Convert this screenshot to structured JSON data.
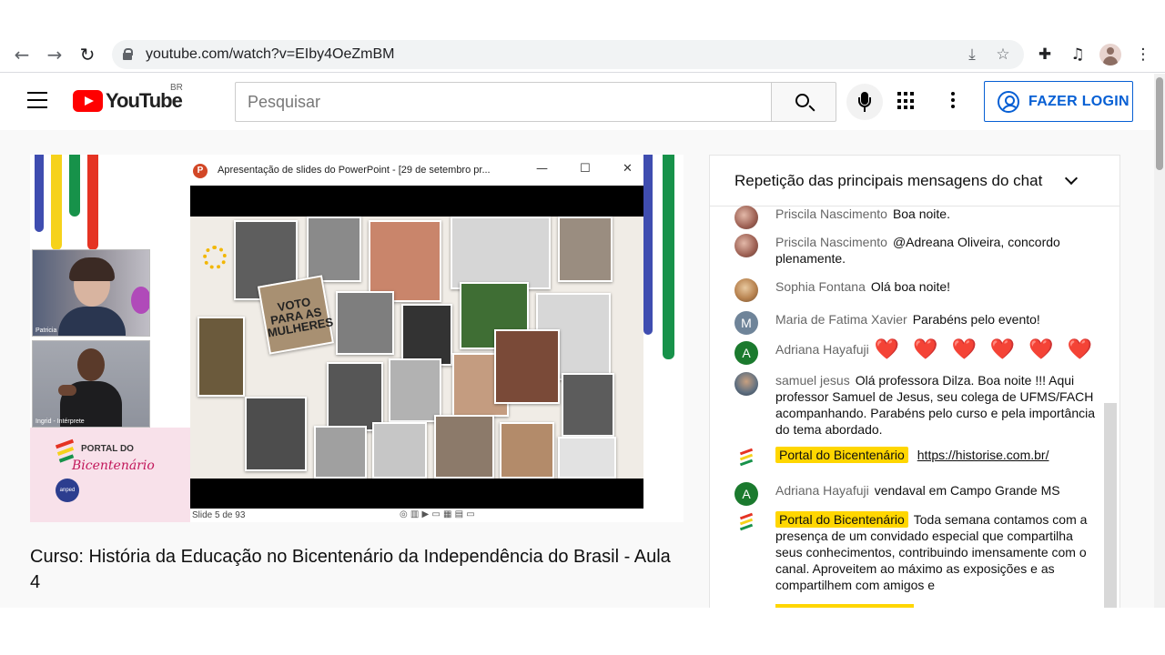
{
  "browser": {
    "url": "youtube.com/watch?v=EIby4OeZmBM"
  },
  "youtube": {
    "logo_text": "YouTube",
    "region": "BR",
    "search_placeholder": "Pesquisar",
    "login_label": "FAZER LOGIN"
  },
  "video": {
    "ppt_title": "Apresentação de slides do PowerPoint - [29 de setembro pr...",
    "slide_counter": "Slide 5 de 93",
    "cam1_label": "Patricia",
    "cam2_label": "Ingrid - Intérprete",
    "sign_text": "VOTO PARA AS MULHERES",
    "portal_logo_line1": "PORTAL DO",
    "portal_logo_line2": "Bicentenário",
    "anped_label": "anped",
    "title": "Curso: História da Educação no Bicentenário da Independência do Brasil - Aula 4"
  },
  "chat": {
    "header": "Repetição das principais mensagens do chat",
    "messages": [
      {
        "author": "Priscila Nascimento",
        "text": "Boa noite."
      },
      {
        "author": "Priscila Nascimento",
        "text": "@Adreana Oliveira, concordo plenamente."
      },
      {
        "author": "Sophia Fontana",
        "text": "Olá boa noite!"
      },
      {
        "author": "Maria de Fatima Xavier",
        "text": "Parabéns pelo evento!",
        "avatar_letter": "M"
      },
      {
        "author": "Adriana Hayafuji",
        "text": "❤️ ❤️ ❤️ ❤️ ❤️ ❤️",
        "avatar_letter": "A"
      },
      {
        "author": "samuel jesus",
        "text": "Olá professora Dilza. Boa noite !!! Aqui professor Samuel de Jesus, seu colega de UFMS/FACH acompanhando. Parabéns pelo curso e pela importância do tema abordado."
      },
      {
        "author": "Portal do Bicentenário",
        "text": "https://historise.com.br/"
      },
      {
        "author": "Adriana Hayafuji",
        "text": "vendaval em Campo Grande MS",
        "avatar_letter": "A"
      },
      {
        "author": "Portal do Bicentenário",
        "text": "Toda semana contamos com a presença de um convidado especial que compartilha seus conhecimentos, contribuindo imensamente com o canal. Aproveitem ao máximo as exposições e as compartilhem com amigos e"
      }
    ]
  },
  "colors": {
    "accent_blue": "#065fd4",
    "owner_badge": "#ffd600",
    "yt_red": "#ff0000",
    "avatar_green": "#1b7a2e",
    "avatar_grey": "#6f8499"
  }
}
